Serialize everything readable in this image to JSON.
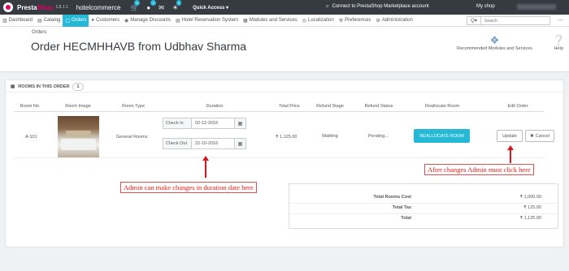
{
  "topbar": {
    "brand_a": "Presta",
    "brand_b": "Shop",
    "version": "1.6.1.1",
    "shop_name": "hotelcommerce",
    "badges": [
      "6",
      "3",
      "2"
    ],
    "quick_access": "Quick Access ▾",
    "connect": "Connect to PrestaShop Marketplace account",
    "my_shop": "My shop"
  },
  "menu": [
    {
      "label": "Dashboard",
      "icon": "dashboard-icon"
    },
    {
      "label": "Catalog",
      "icon": "catalog-icon"
    },
    {
      "label": "Orders",
      "icon": "orders-icon"
    },
    {
      "label": "Customers",
      "icon": "customers-icon"
    },
    {
      "label": "Manage Discounts",
      "icon": "discounts-icon"
    },
    {
      "label": "Hotel Reservation System",
      "icon": "hotel-icon"
    },
    {
      "label": "Modules and Services",
      "icon": "modules-icon"
    },
    {
      "label": "Localization",
      "icon": "globe-icon"
    },
    {
      "label": "Preferences",
      "icon": "wrench-icon"
    },
    {
      "label": "Administration",
      "icon": "gear-icon"
    }
  ],
  "search": {
    "placeholder": "Search",
    "button": "Q▾"
  },
  "header": {
    "breadcrumb": "Orders",
    "title": "Order HECMHHAVB from Udbhav Sharma",
    "recommended": "Recommended Modules and Services",
    "help": "Help"
  },
  "panel": {
    "title": "ROOMS IN THIS ORDER",
    "count": "1",
    "columns": [
      "Room No.",
      "Room Image",
      "Room Type",
      "Duration",
      "Total Price",
      "Refund Stage",
      "Refund Status",
      "Reallocate Room",
      "Edit Order"
    ],
    "row": {
      "room_no": "A-101",
      "room_type": "General Rooms",
      "check_in_label": "Check In",
      "check_in": "02-12-2016",
      "check_out_label": "Check Out",
      "check_out": "22-10-2016",
      "total_price": "₹ 1,125.00",
      "refund_stage": "Waitting",
      "refund_status": "Pending...",
      "reallocate": "REALLOCATE ROOM",
      "update": "Update",
      "cancel": "Cancel"
    },
    "totals": [
      {
        "label": "Total Rooms Cost",
        "value": "₹ 1,000.00"
      },
      {
        "label": "Total Tax",
        "value": "₹ 125.00"
      },
      {
        "label": "Total",
        "value": "₹ 1,125.00"
      }
    ]
  },
  "annotations": {
    "duration": "Admin can make changes in duration date here",
    "update": "After changes Admin must click here"
  },
  "colors": {
    "accent": "#25b9d7",
    "brand": "#df0067",
    "topbar": "#363a41",
    "annotation": "#e01b1b"
  }
}
